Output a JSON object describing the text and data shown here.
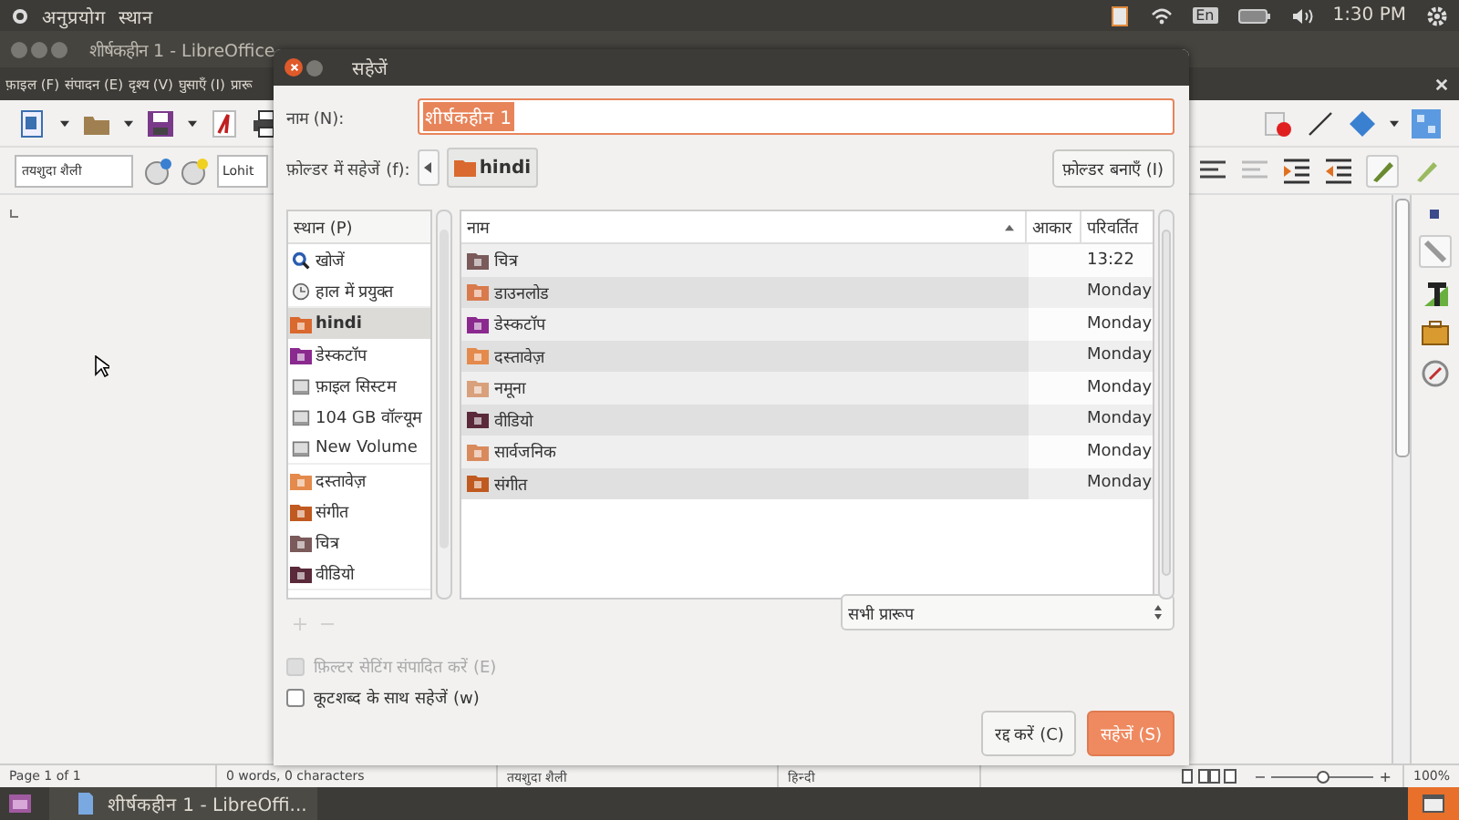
{
  "top_panel": {
    "menus": [
      "अनुप्रयोग",
      "स्थान"
    ],
    "keyboard": "En",
    "clock": "1:30 PM"
  },
  "window": {
    "title": "शीर्षकहीन 1 - LibreOffice",
    "menus": [
      "फ़ाइल (F)",
      "संपादन (E)",
      "दृश्य (V)",
      "घुसाएँ (I)",
      "प्रारू"
    ]
  },
  "toolbar": {
    "paragraph_style": "तयशुदा शैली",
    "font_name": "Lohit"
  },
  "dialog": {
    "title": "सहेजें",
    "name_label": "नाम (N):",
    "name_value": "शीर्षकहीन 1",
    "name_text_selected": true,
    "folder_label": "फ़ोल्डर में सहेजें (f):",
    "folder_crumb": "hindi",
    "create_folder": "फ़ोल्डर बनाएँ (I)",
    "places": {
      "header": "स्थान (P)",
      "groups": [
        {
          "items": [
            {
              "label": "खोजें",
              "kind": "search",
              "selected": false
            },
            {
              "label": "हाल में प्रयुक्त",
              "kind": "recent",
              "selected": false
            }
          ]
        },
        {
          "items": [
            {
              "label": "hindi",
              "kind": "home",
              "selected": true
            },
            {
              "label": "डेस्कटॉप",
              "kind": "desktop",
              "selected": false
            },
            {
              "label": "फ़ाइल सिस्टम",
              "kind": "drive",
              "selected": false
            },
            {
              "label": "104 GB वॉल्यूम",
              "kind": "drive",
              "selected": false
            },
            {
              "label": "New Volume",
              "kind": "drive",
              "selected": false
            }
          ]
        },
        {
          "items": [
            {
              "label": "दस्तावेज़",
              "kind": "documents",
              "selected": false
            },
            {
              "label": "संगीत",
              "kind": "music",
              "selected": false
            },
            {
              "label": "चित्र",
              "kind": "pictures",
              "selected": false
            },
            {
              "label": "वीडियो",
              "kind": "videos",
              "selected": false
            }
          ]
        }
      ]
    },
    "files": {
      "columns": [
        "नाम",
        "आकार",
        "परिवर्तित"
      ],
      "rows": [
        {
          "name": "चित्र",
          "kind": "pictures",
          "modified": "13:22"
        },
        {
          "name": "डाउनलोड",
          "kind": "downloads",
          "modified": "Monday"
        },
        {
          "name": "डेस्कटॉप",
          "kind": "desktop",
          "modified": "Monday"
        },
        {
          "name": "दस्तावेज़",
          "kind": "documents",
          "modified": "Monday"
        },
        {
          "name": "नमूना",
          "kind": "templates",
          "modified": "Monday"
        },
        {
          "name": "वीडियो",
          "kind": "videos",
          "modified": "Monday"
        },
        {
          "name": "सार्वजनिक",
          "kind": "public",
          "modified": "Monday"
        },
        {
          "name": "संगीत",
          "kind": "music",
          "modified": "Monday"
        }
      ]
    },
    "filter": "सभी प्रारूप",
    "options": [
      {
        "label": "फ़िल्टर सेटिंग संपादित करें (E)",
        "checked": false,
        "disabled": true
      },
      {
        "label": "कूटशब्द के साथ सहेजें (w)",
        "checked": false,
        "disabled": false
      }
    ],
    "buttons": [
      {
        "label": "रद्द करें (C)",
        "kind": "secondary"
      },
      {
        "label": "सहेजें (S)",
        "kind": "primary"
      }
    ]
  },
  "status_bar": {
    "page": "Page 1 of 1",
    "words": "0 words, 0 characters",
    "style": "तयशुदा शैली",
    "language": "हिन्दी",
    "zoom_out": "−",
    "zoom_slider": {
      "level": 0.5
    },
    "zoom_in": "+",
    "zoom": "100%"
  },
  "taskbar": {
    "task": "शीर्षकहीन 1 - LibreOffi..."
  }
}
